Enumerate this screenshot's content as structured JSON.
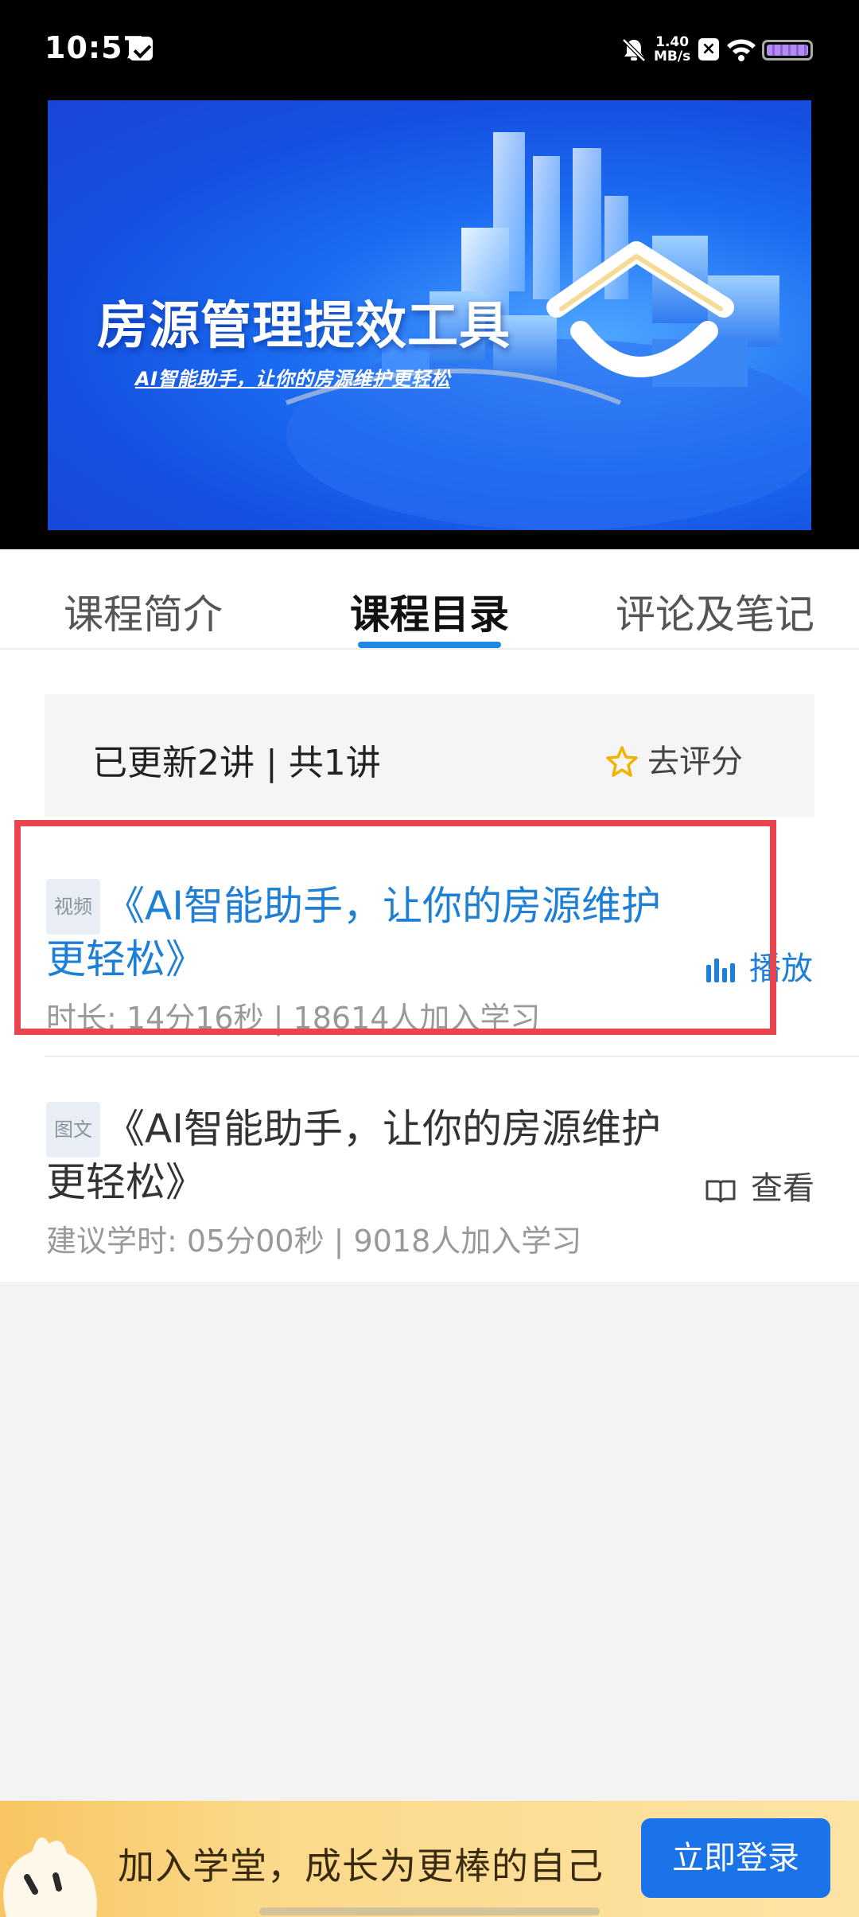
{
  "status_bar": {
    "time": "10:57",
    "net_speed_value": "1.40",
    "net_speed_unit": "MB/s"
  },
  "banner": {
    "title": "房源管理提效工具",
    "subtitle": "AI智能助手，让你的房源维护更轻松"
  },
  "tabs": [
    {
      "label": "课程简介",
      "active": false
    },
    {
      "label": "课程目录",
      "active": true
    },
    {
      "label": "评论及笔记",
      "active": false
    }
  ],
  "summary": {
    "text": "已更新2讲 | 共1讲",
    "rate_label": "去评分"
  },
  "lessons": [
    {
      "badge": "视频",
      "title": "《AI智能助手，让你的房源维护更轻松》",
      "meta": "时长: 14分16秒 | 18614人加入学习",
      "action": "播放",
      "action_icon": "bar-chart-icon"
    },
    {
      "badge": "图文",
      "title": "《AI智能助手，让你的房源维护更轻松》",
      "meta": "建议学时: 05分00秒 | 9018人加入学习",
      "action": "查看",
      "action_icon": "book-icon"
    }
  ],
  "bottom_bar": {
    "text": "加入学堂，成长为更棒的自己",
    "login_button": "立即登录"
  },
  "colors": {
    "accent": "#1e7fd6",
    "highlight_border": "#e8454e",
    "login_button": "#1a73e8",
    "star": "#f0b400"
  }
}
